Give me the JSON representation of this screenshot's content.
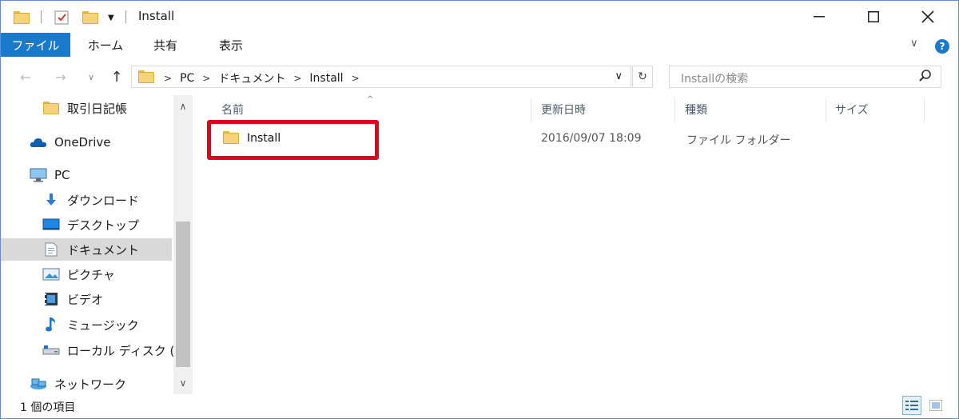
{
  "window": {
    "title": "Install",
    "controls": {
      "minimize": "—",
      "maximize": "☐",
      "close": "✕"
    }
  },
  "ribbon": {
    "tabs": [
      {
        "label": "ファイル",
        "active": true
      },
      {
        "label": "ホーム",
        "active": false
      },
      {
        "label": "共有",
        "active": false
      },
      {
        "label": "表示",
        "active": false
      }
    ],
    "expand_glyph": "∨",
    "help_glyph": "?"
  },
  "nav": {
    "back": "←",
    "forward": "→",
    "recent": "∨",
    "up": "↑"
  },
  "address": {
    "path": [
      "PC",
      "ドキュメント",
      "Install"
    ],
    "separator": ">",
    "dropdown": "∨",
    "refresh": "↻"
  },
  "search": {
    "placeholder": "Installの検索"
  },
  "sidebar": {
    "items": [
      {
        "label": "取引日記帳",
        "icon": "folder-icon"
      },
      {
        "label": "OneDrive",
        "icon": "cloud-icon"
      },
      {
        "label": "PC",
        "icon": "computer-icon"
      },
      {
        "label": "ダウンロード",
        "icon": "download-icon"
      },
      {
        "label": "デスクトップ",
        "icon": "desktop-icon"
      },
      {
        "label": "ドキュメント",
        "icon": "documents-icon",
        "selected": true
      },
      {
        "label": "ピクチャ",
        "icon": "pictures-icon"
      },
      {
        "label": "ビデオ",
        "icon": "video-icon"
      },
      {
        "label": "ミュージック",
        "icon": "music-icon"
      },
      {
        "label": "ローカル ディスク (C",
        "icon": "drive-icon"
      },
      {
        "label": "ネットワーク",
        "icon": "network-icon"
      }
    ],
    "scroll_up": "∧",
    "scroll_down": "∨"
  },
  "columns": [
    "名前",
    "更新日時",
    "種類",
    "サイズ"
  ],
  "sort_indicator": "^",
  "files": [
    {
      "name": "Install",
      "modified": "2016/09/07 18:09",
      "type": "ファイル フォルダー",
      "size": ""
    }
  ],
  "colors": {
    "accent": "#1979ca",
    "highlight_border": "#e1001e",
    "selection": "#d9d9d9"
  },
  "status": {
    "item_count": "1 個の項目"
  }
}
